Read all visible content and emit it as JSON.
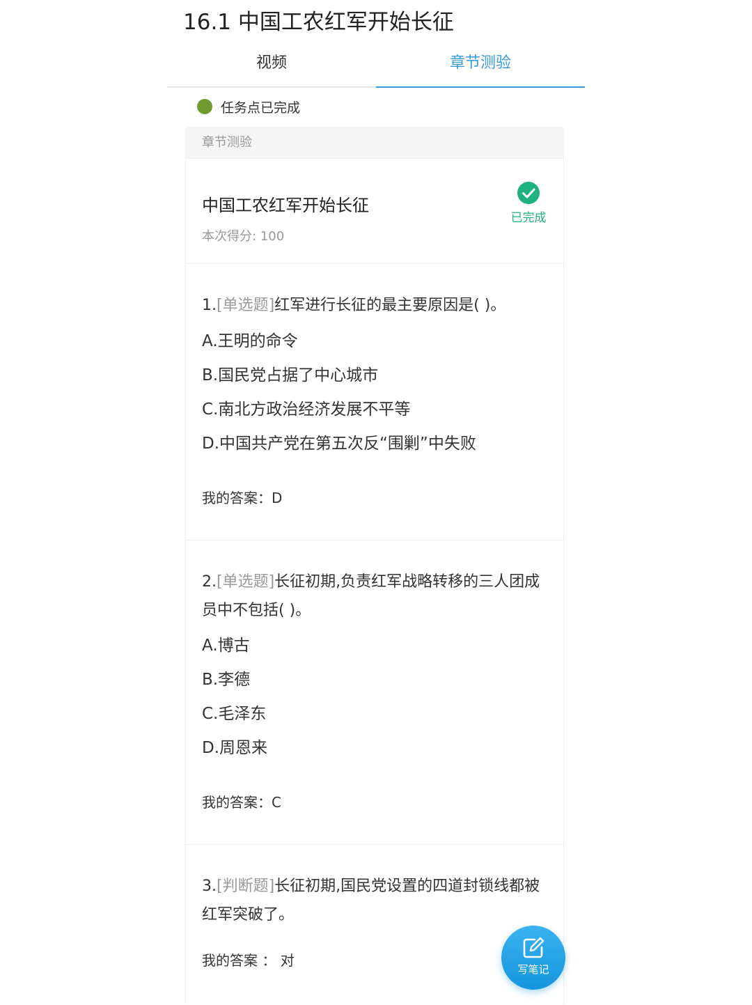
{
  "page": {
    "title": "16.1 中国工农红军开始长征"
  },
  "tabs": [
    {
      "label": "视频",
      "active": false
    },
    {
      "label": "章节测验",
      "active": true
    }
  ],
  "task_status": {
    "text": "任务点已完成",
    "dot_color": "#6f9a2f"
  },
  "card": {
    "header": "章节测验",
    "quiz_title": "中国工农红军开始长征",
    "score": "本次得分: 100",
    "status_label": "已完成",
    "status_color": "#1fb17f"
  },
  "questions": [
    {
      "number": "1.",
      "type": "[单选题]",
      "text": "红军进行长征的最主要原因是( )。",
      "options": [
        "A.王明的命令",
        "B.国民党占据了中心城市",
        "C.南北方政治经济发展不平等",
        "D.中国共产党在第五次反“围剿”中失败"
      ],
      "answer": "我的答案：D"
    },
    {
      "number": "2.",
      "type": "[单选题]",
      "text": "长征初期,负责红军战略转移的三人团成员中不包括( )。",
      "options": [
        "A.博古",
        "B.李德",
        "C.毛泽东",
        "D.周恩来"
      ],
      "answer": "我的答案：C"
    },
    {
      "number": "3.",
      "type": "[判断题]",
      "text": "长征初期,国民党设置的四道封锁线都被红军突破了。",
      "options": [],
      "answer": "我的答案 ： 对"
    }
  ],
  "note_button": {
    "label": "写笔记",
    "icon": "pen-icon",
    "color": "#1596de"
  },
  "colors": {
    "accent": "#3a9bd9",
    "muted": "#999999"
  }
}
